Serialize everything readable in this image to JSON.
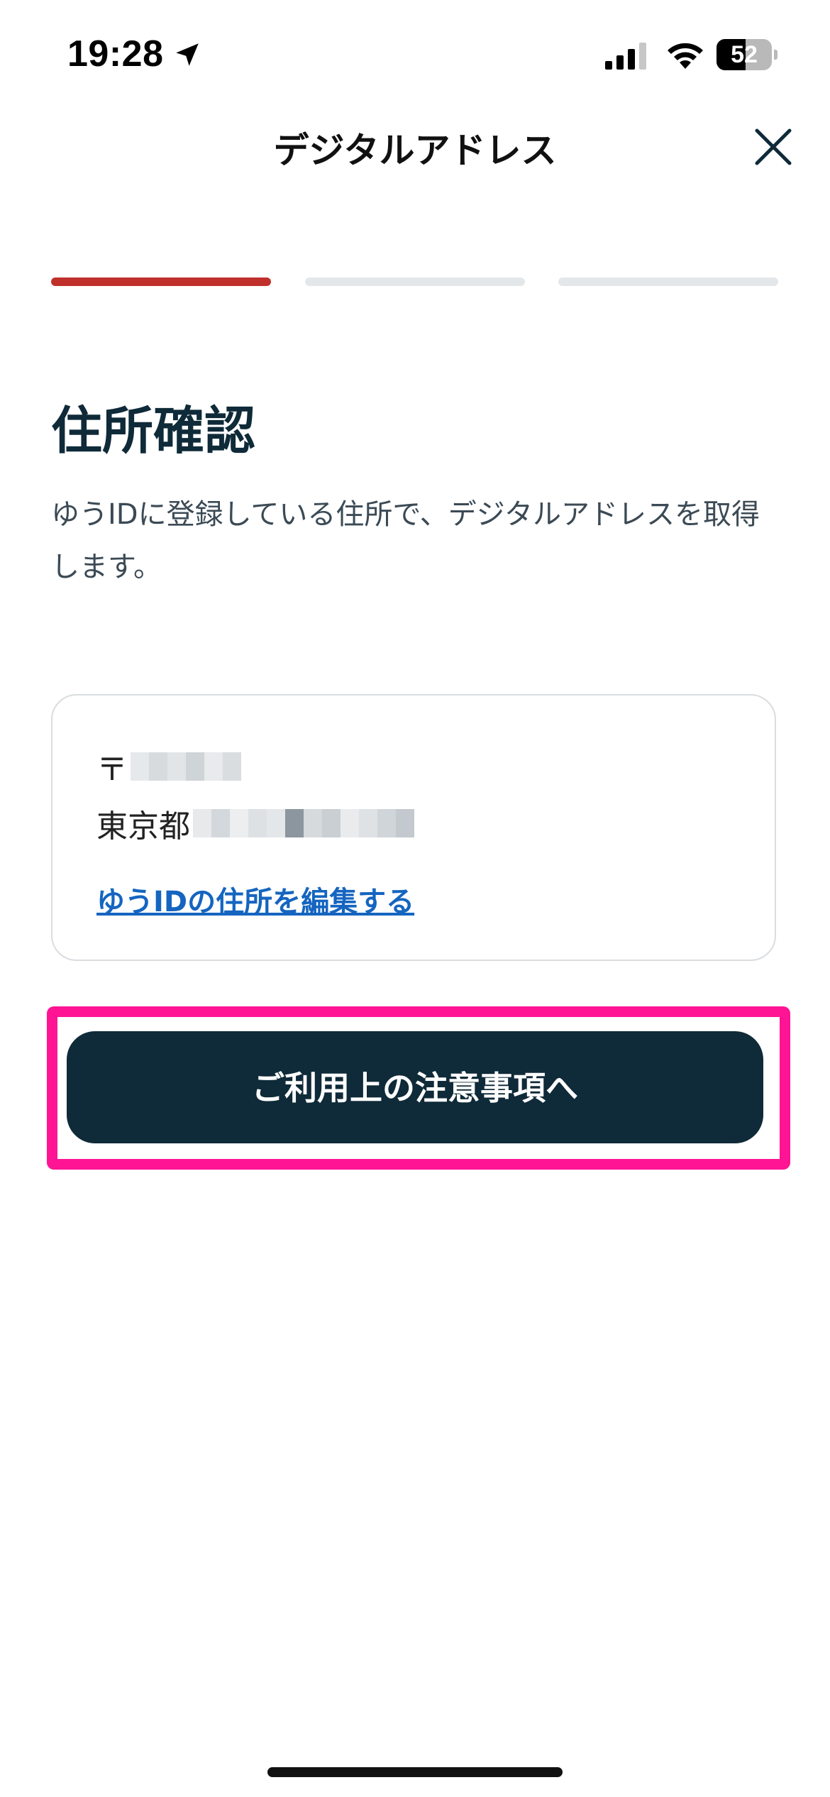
{
  "status_bar": {
    "time": "19:28",
    "battery_level": "52",
    "battery_fill_fraction": 0.52,
    "icons": [
      "location-arrow-icon",
      "cellular-signal-icon",
      "wifi-icon",
      "battery-icon"
    ]
  },
  "header": {
    "title": "デジタルアドレス",
    "close_icon": "close-icon"
  },
  "steps": {
    "total": 3,
    "current": 1,
    "active_color": "#c0302b",
    "inactive_color": "#e4e7e9"
  },
  "page": {
    "heading": "住所確認",
    "description": "ゆうIDに登録している住所で、デジタルアドレスを取得します。"
  },
  "address_card": {
    "postal_prefix": "〒",
    "prefecture": "東京都",
    "edit_link": "ゆうIDの住所を編集する"
  },
  "primary_button": {
    "label": "ご利用上の注意事項へ"
  },
  "colors": {
    "primary": "#0f2a38",
    "link": "#1565c0",
    "highlight": "#ff1493"
  }
}
